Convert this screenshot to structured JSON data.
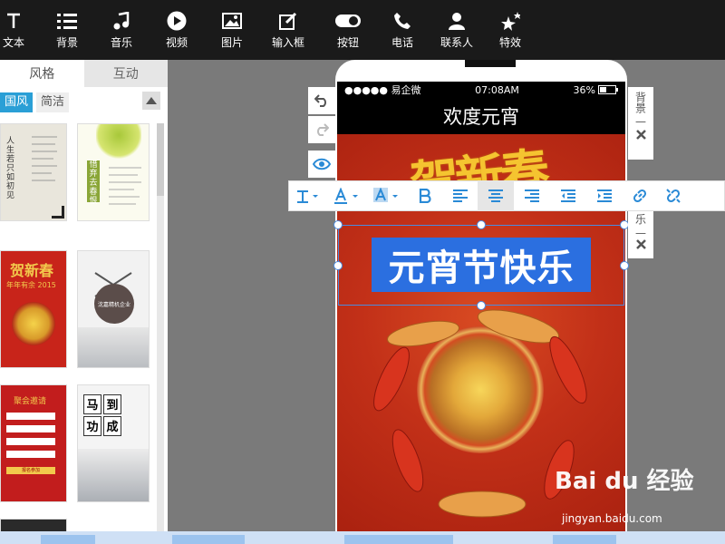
{
  "toolbar": [
    {
      "key": "text",
      "label": "文本",
      "icon": "text-icon"
    },
    {
      "key": "background",
      "label": "背景",
      "icon": "list-icon"
    },
    {
      "key": "music",
      "label": "音乐",
      "icon": "music-note-icon"
    },
    {
      "key": "video",
      "label": "视频",
      "icon": "play-icon"
    },
    {
      "key": "image",
      "label": "图片",
      "icon": "image-icon"
    },
    {
      "key": "input",
      "label": "输入框",
      "icon": "edit-icon"
    },
    {
      "key": "button",
      "label": "按钮",
      "icon": "toggle-icon"
    },
    {
      "key": "phone",
      "label": "电话",
      "icon": "phone-icon"
    },
    {
      "key": "contact",
      "label": "联系人",
      "icon": "person-icon"
    },
    {
      "key": "effect",
      "label": "特效",
      "icon": "sparkle-icon"
    }
  ],
  "left": {
    "tabs": [
      "风格",
      "互动"
    ],
    "chips": [
      "国风",
      "简洁"
    ],
    "thumb_texts": {
      "t1": "人生若只如初见",
      "t2": "惜弃去春恨",
      "t3": "年年有余 2015",
      "t4": "沈嘉精机企业",
      "t5": "聚会邀请",
      "t5b": "报名参加",
      "t6a": "马",
      "t6b": "到",
      "t6c": "功",
      "t6d": "成"
    }
  },
  "phone": {
    "carrier": "●●●●● 易企微",
    "time": "07:08AM",
    "battery": "36%",
    "title": "欢度元宵",
    "headline": "元宵节快乐",
    "calligraphy": "贺新春"
  },
  "right_panel": {
    "bg_label": "背景",
    "dash": "—",
    "partial": "乐"
  },
  "watermark": {
    "brand": "Bai du 经验",
    "url": "jingyan.baidu.com"
  },
  "colors": {
    "accent": "#2a9fd6",
    "selection": "#2b6fe0",
    "poster": "#c52a1c"
  }
}
